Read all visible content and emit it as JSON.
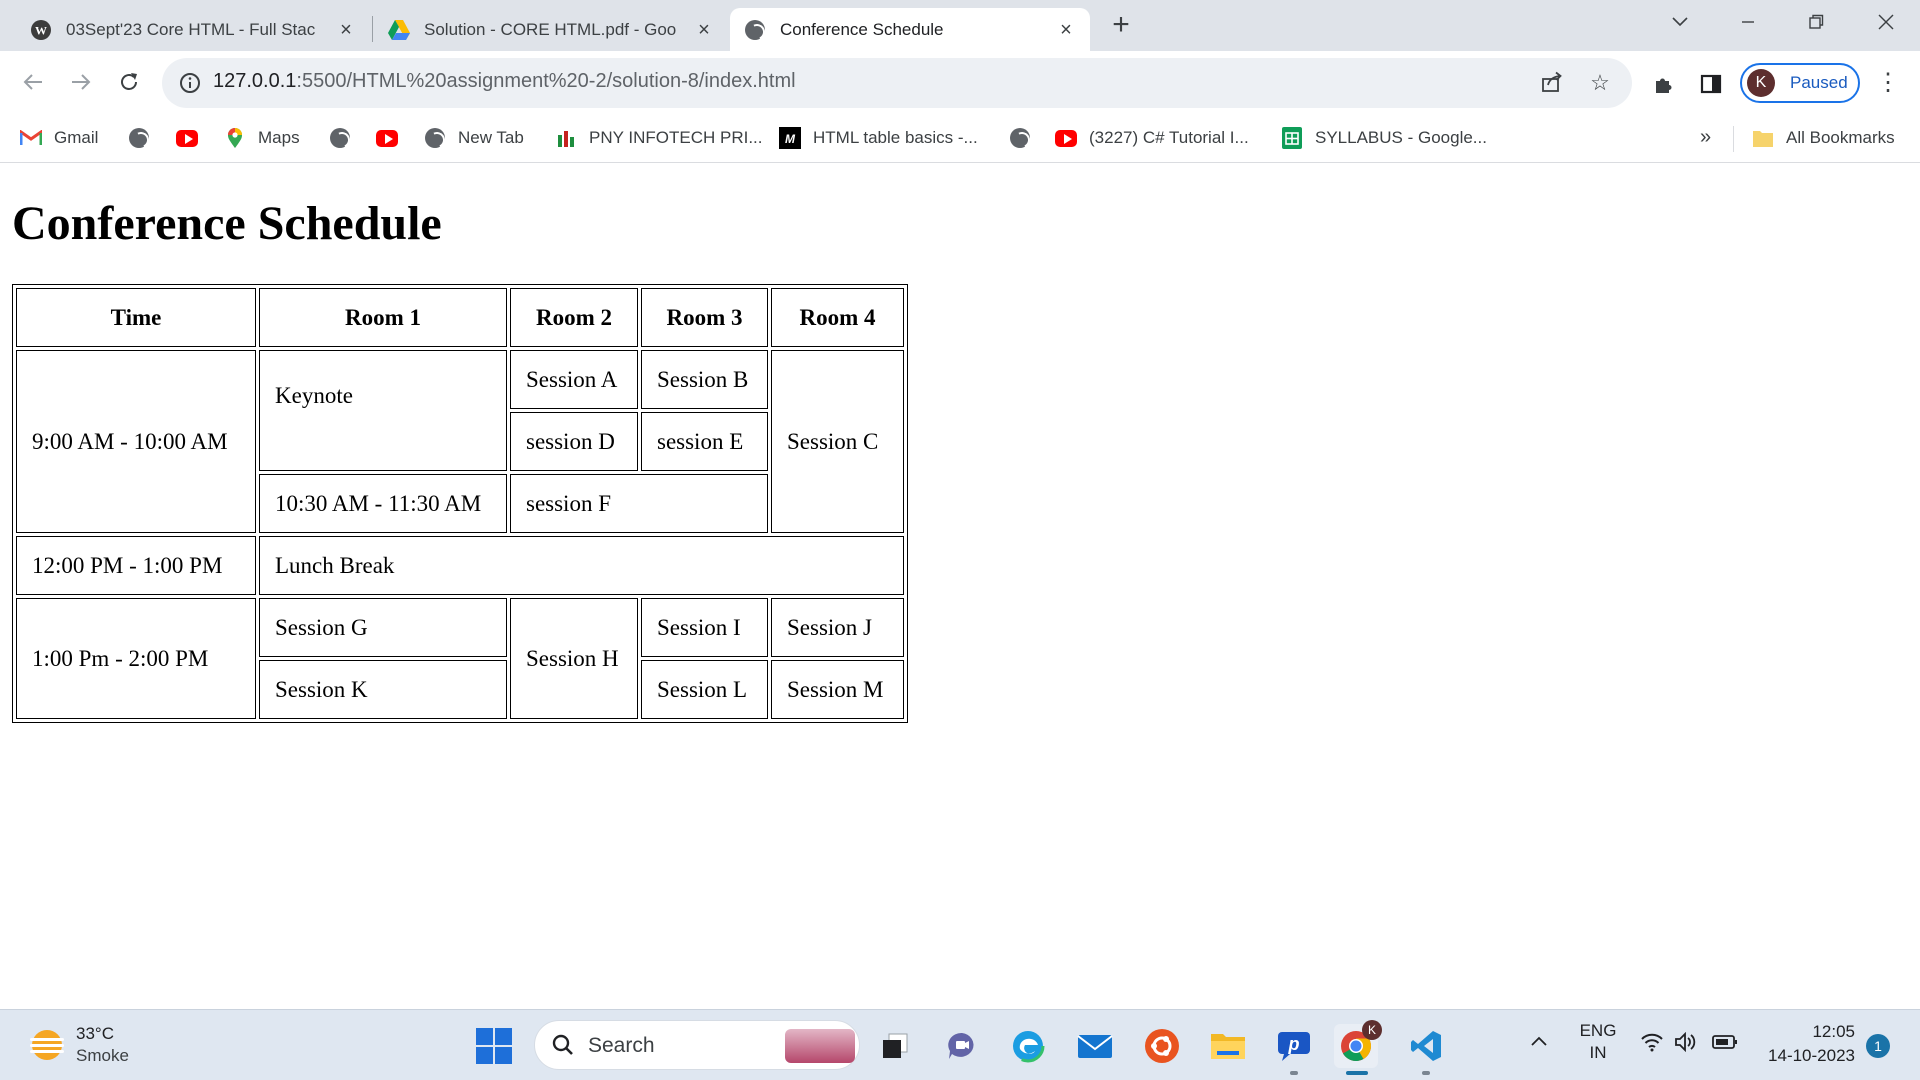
{
  "browser": {
    "tabs": [
      {
        "title": "03Sept'23 Core HTML - Full Stac",
        "active": false
      },
      {
        "title": "Solution - CORE HTML.pdf - Goo",
        "active": false
      },
      {
        "title": "Conference Schedule",
        "active": true
      }
    ],
    "url_host": "127.0.0.1",
    "url_path": ":5500/HTML%20assignment%20-2/solution-8/index.html",
    "profile_initial": "K",
    "profile_status": "Paused"
  },
  "bookmarks": {
    "gmail": "Gmail",
    "maps": "Maps",
    "new_tab": "New Tab",
    "pny": "PNY INFOTECH PRI...",
    "html_table": "HTML table basics -...",
    "csharp": "(3227) C# Tutorial I...",
    "syllabus": "SYLLABUS - Google...",
    "overflow": "»",
    "all_bookmarks": "All Bookmarks"
  },
  "page": {
    "title": "Conference Schedule",
    "headers": [
      "Time",
      "Room 1",
      "Room 2",
      "Room 3",
      "Room 4"
    ],
    "cells": {
      "time_1": "9:00 AM - 10:00 AM",
      "keynote": "Keynote",
      "session_a": "Session A",
      "session_b": "Session B",
      "session_c": "Session C",
      "session_d": "session D",
      "session_e": "session E",
      "time_1030": "10:30 AM - 11:30 AM",
      "session_f": "session F",
      "time_lunch": "12:00 PM - 1:00 PM",
      "lunch": "Lunch Break",
      "time_afternoon": "1:00 Pm - 2:00 PM",
      "session_g": "Session G",
      "session_h": "Session H",
      "session_i": "Session I",
      "session_j": "Session J",
      "session_k": "Session K",
      "session_l": "Session L",
      "session_m": "Session M"
    }
  },
  "taskbar": {
    "temperature": "33°C",
    "condition": "Smoke",
    "search_placeholder": "Search",
    "lang_top": "ENG",
    "lang_bottom": "IN",
    "time": "12:05",
    "date": "14-10-2023",
    "notifications": "1",
    "chrome_badge": "K"
  },
  "colors": {
    "accent": "#1a73e8",
    "tabstrip": "#dfe3e9",
    "taskbar": "#dfe7f1"
  }
}
